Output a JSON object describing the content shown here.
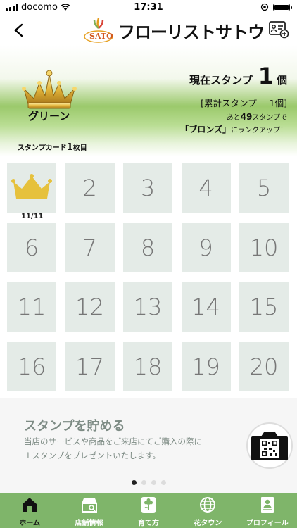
{
  "status_bar": {
    "carrier": "docomo",
    "time": "17:31"
  },
  "nav": {
    "logo_text": "フローリストサトウ",
    "logo_sub": "SATO"
  },
  "rank": {
    "name": "グリーン",
    "current_label": "現在スタンプ",
    "current_count": "1",
    "current_unit": "個",
    "total_label": "[累計スタンプ",
    "total_count": "1個]",
    "rankup_prefix": "あと",
    "rankup_count": "49",
    "rankup_suffix": "スタンプで",
    "rankup_rank": "「ブロンズ」",
    "rankup_tail": "にランクアップ！"
  },
  "card": {
    "label": "スタンプカード",
    "number": "1",
    "unit": "枚目"
  },
  "stamps": {
    "stamped_date": "11/11",
    "cells": [
      "1",
      "2",
      "3",
      "4",
      "5",
      "6",
      "7",
      "8",
      "9",
      "10",
      "11",
      "12",
      "13",
      "14",
      "15",
      "16",
      "17",
      "18",
      "19",
      "20"
    ]
  },
  "info": {
    "title": "スタンプを貯める",
    "line1": "当店のサービスや商品をご来店にてご購入の際に",
    "line2": "１スタンプをプレゼントいたします。"
  },
  "tabs": [
    {
      "label": "ホーム",
      "icon": "home-icon"
    },
    {
      "label": "店舗情報",
      "icon": "store-icon"
    },
    {
      "label": "育て方",
      "icon": "flower-icon"
    },
    {
      "label": "花タウン",
      "icon": "globe-icon"
    },
    {
      "label": "プロフィール",
      "icon": "profile-icon"
    }
  ],
  "colors": {
    "tab_bar": "#7fb56a",
    "crown_gold": "#e6c13c",
    "stamp_bg": "#e4ebe7"
  }
}
